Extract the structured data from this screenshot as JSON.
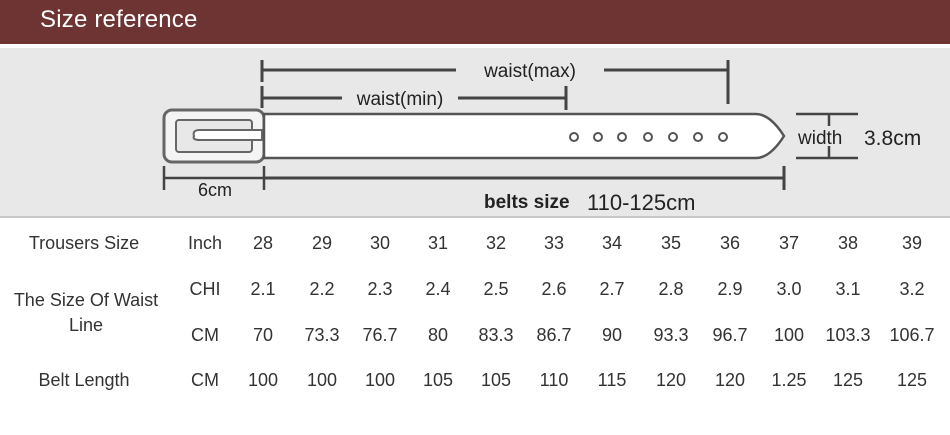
{
  "header": {
    "title": "Size reference"
  },
  "diagram": {
    "waist_max_label": "waist(max)",
    "waist_min_label": "waist(min)",
    "width_label": "width",
    "width_value": "3.8cm",
    "buckle_label": "6cm",
    "belts_size_label": "belts size",
    "belts_size_value": "110-125cm"
  },
  "table": {
    "trousers_label": "Trousers Size",
    "waist_label_line1": "The Size Of Waist",
    "waist_label_line2": "Line",
    "belt_label": "Belt Length",
    "units": {
      "inch": "Inch",
      "chi": "CHI",
      "cm": "CM",
      "belt_cm": "CM"
    },
    "inch": [
      "28",
      "29",
      "30",
      "31",
      "32",
      "33",
      "34",
      "35",
      "36",
      "37",
      "38",
      "39"
    ],
    "chi": [
      "2.1",
      "2.2",
      "2.3",
      "2.4",
      "2.5",
      "2.6",
      "2.7",
      "2.8",
      "2.9",
      "3.0",
      "3.1",
      "3.2"
    ],
    "cm": [
      "70",
      "73.3",
      "76.7",
      "80",
      "83.3",
      "86.7",
      "90",
      "93.3",
      "96.7",
      "100",
      "103.3",
      "106.7"
    ],
    "belt": [
      "100",
      "100",
      "100",
      "105",
      "105",
      "110",
      "115",
      "120",
      "120",
      "1.25",
      "125",
      "125"
    ]
  }
}
